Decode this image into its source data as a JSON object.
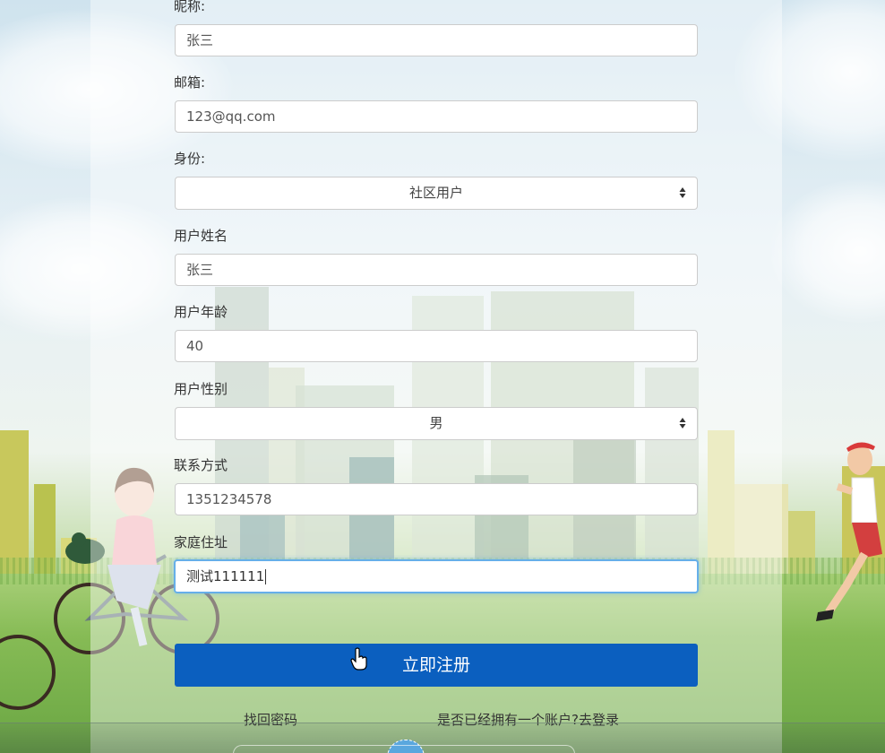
{
  "form": {
    "nickname": {
      "label": "昵称:",
      "value": "张三"
    },
    "email": {
      "label": "邮箱:",
      "value": "123@qq.com"
    },
    "identity": {
      "label": "身份:",
      "value": "社区用户"
    },
    "username": {
      "label": "用户姓名",
      "value": "张三"
    },
    "age": {
      "label": "用户年龄",
      "value": "40"
    },
    "gender": {
      "label": "用户性别",
      "value": "男"
    },
    "contact": {
      "label": "联系方式",
      "value": "1351234578"
    },
    "address": {
      "label": "家庭住址",
      "value": "测试111111"
    },
    "submit_label": "立即注册"
  },
  "links": {
    "forgot_password": "找回密码",
    "login_prompt": "是否已经拥有一个账户?去登录"
  },
  "colors": {
    "primary_button": "#0b5fbf",
    "focus_border": "#66afe9"
  }
}
